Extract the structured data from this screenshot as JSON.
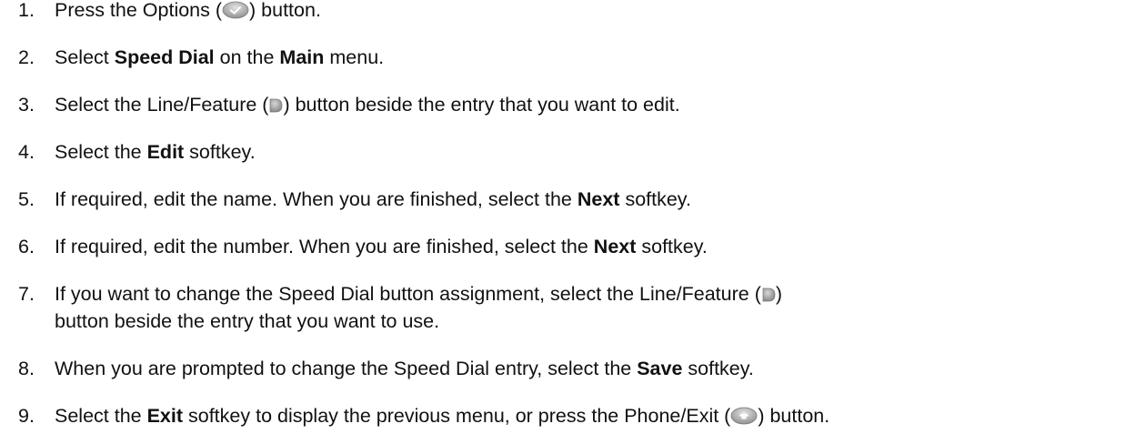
{
  "steps": [
    {
      "num": "1.",
      "parts": [
        {
          "t": "Press the Options ("
        },
        {
          "icon": "options-button-icon"
        },
        {
          "t": ") button."
        }
      ]
    },
    {
      "num": "2.",
      "parts": [
        {
          "t": "Select "
        },
        {
          "b": "Speed Dial"
        },
        {
          "t": " on the "
        },
        {
          "b": "Main"
        },
        {
          "t": " menu."
        }
      ]
    },
    {
      "num": "3.",
      "parts": [
        {
          "t": "Select the Line/Feature ("
        },
        {
          "icon": "line-feature-button-icon"
        },
        {
          "t": ") button beside the entry that you want to edit."
        }
      ]
    },
    {
      "num": "4.",
      "parts": [
        {
          "t": "Select the "
        },
        {
          "b": "Edit"
        },
        {
          "t": " softkey."
        }
      ]
    },
    {
      "num": "5.",
      "parts": [
        {
          "t": "If required, edit the name. When you are finished, select the "
        },
        {
          "b": "Next"
        },
        {
          "t": " softkey."
        }
      ]
    },
    {
      "num": "6.",
      "parts": [
        {
          "t": "If required, edit the number. When you are finished, select the "
        },
        {
          "b": "Next"
        },
        {
          "t": " softkey."
        }
      ]
    },
    {
      "num": "7.",
      "parts": [
        {
          "t": "If you want to change the Speed Dial button assignment, select the Line/Feature ("
        },
        {
          "icon": "line-feature-button-icon"
        },
        {
          "t": ")"
        }
      ],
      "continuation": "button beside the entry that you want to use."
    },
    {
      "num": "8.",
      "parts": [
        {
          "t": "When you are prompted to change the Speed Dial entry, select the "
        },
        {
          "b": "Save"
        },
        {
          "t": " softkey."
        }
      ]
    },
    {
      "num": "9.",
      "parts": [
        {
          "t": "Select the "
        },
        {
          "b": "Exit"
        },
        {
          "t": " softkey to display the previous menu, or press the Phone/Exit ("
        },
        {
          "icon": "phone-exit-button-icon"
        },
        {
          "t": ") button."
        }
      ]
    }
  ]
}
